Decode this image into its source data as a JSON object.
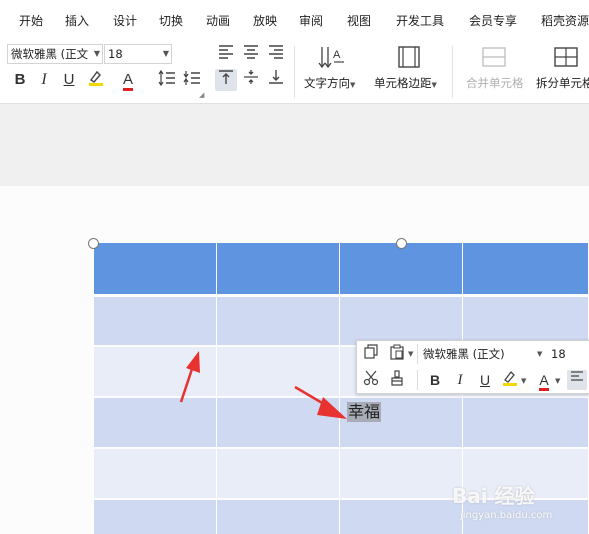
{
  "menu": {
    "items": [
      "开始",
      "插入",
      "设计",
      "切换",
      "动画",
      "放映",
      "审阅",
      "视图",
      "开发工具",
      "会员专享",
      "稻壳资源"
    ]
  },
  "ribbon": {
    "font_name": "微软雅黑 (正文",
    "font_size": "18",
    "text_direction_label": "文字方向",
    "cell_margin_label": "单元格边距",
    "merge_cells_label": "合并单元格",
    "split_cells_label": "拆分单元格"
  },
  "document": {
    "selected_text": "幸福"
  },
  "float_toolbar": {
    "font_name": "微软雅黑 (正文)",
    "font_size": "18"
  },
  "colors": {
    "header_row": "#5f95e0",
    "row_dark": "#cfdaf2",
    "row_light": "#e8edf8",
    "arrow": "#e8322f",
    "font_color_underline": "#e02020",
    "highlight_underline": "#f5d800"
  },
  "watermark": {
    "brand": "Bai 经验",
    "url": "jingyan.baidu.com"
  }
}
